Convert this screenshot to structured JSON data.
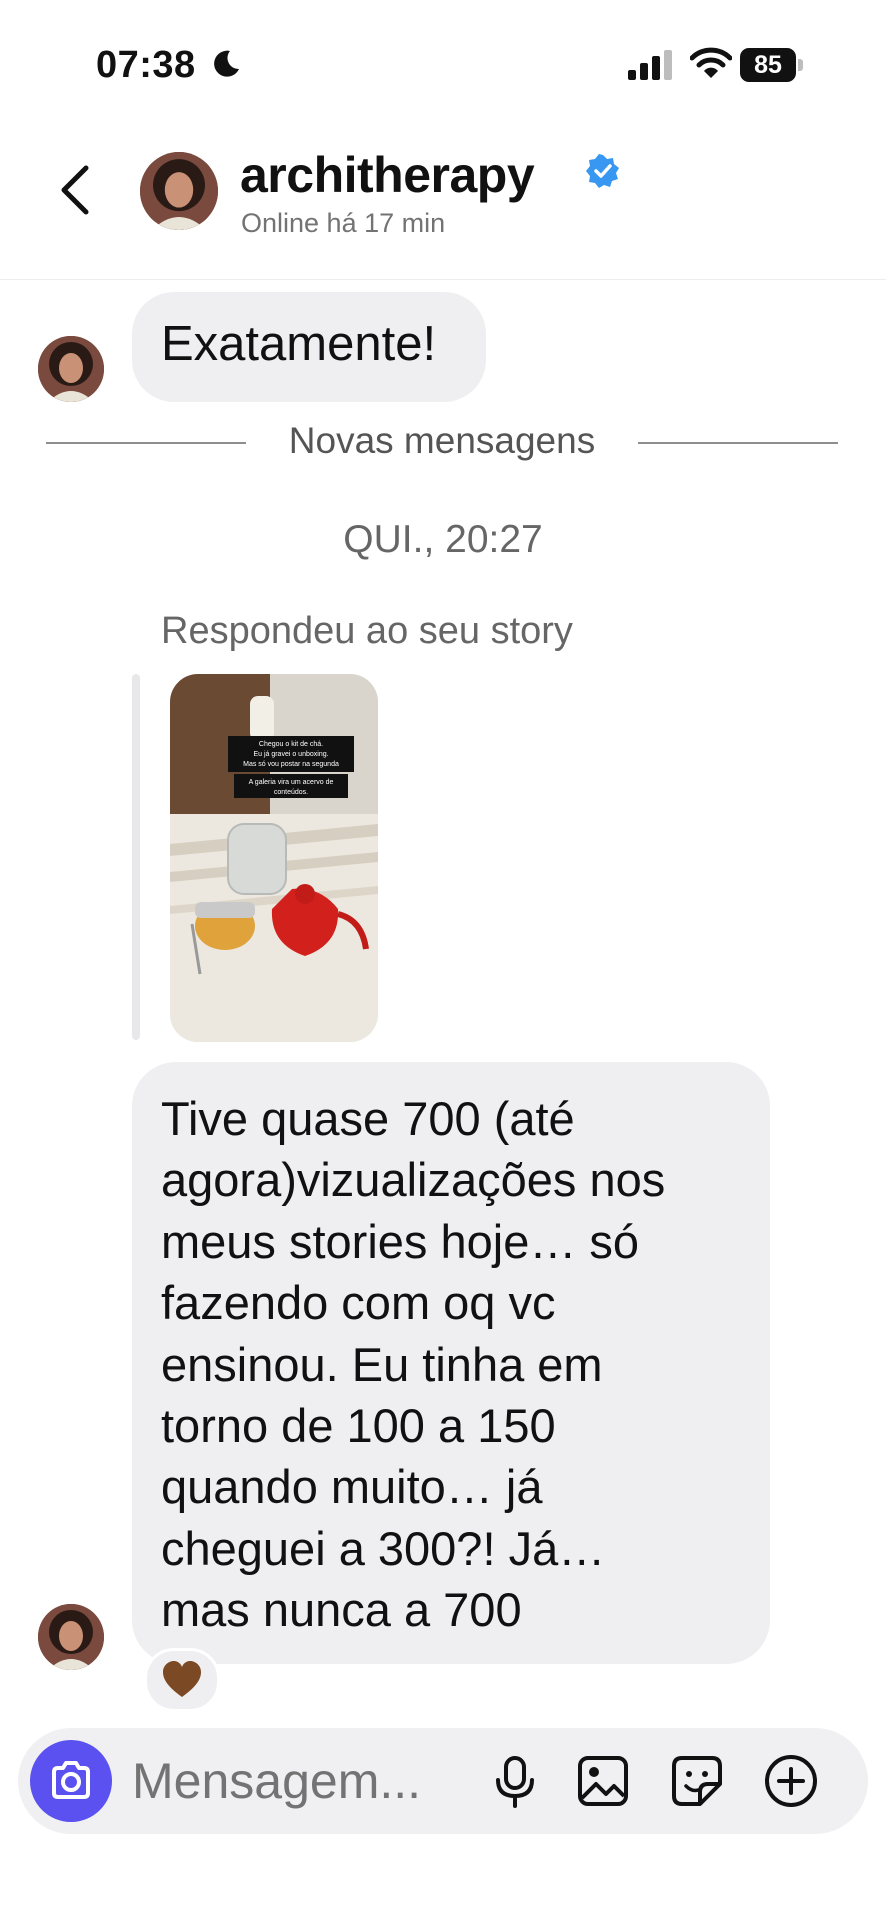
{
  "status_bar": {
    "time": "07:38",
    "battery": "85",
    "icons": [
      "moon-icon",
      "signal-icon",
      "wifi-icon",
      "battery-icon"
    ]
  },
  "header": {
    "username": "architherapy",
    "status": "Online há 17 min",
    "verified": true,
    "icons": [
      "back-chevron-icon",
      "verified-badge-icon"
    ]
  },
  "messages": {
    "first": "Exatamente!",
    "new_messages": "Novas mensagens",
    "date": "QUI., 20:27",
    "replied_label": "Respondeu ao seu story",
    "story_caption_1": "Chegou o kit de chá.\nEu já gravei o unboxing.\nMas só vou postar na segunda",
    "story_caption_2": "A galeria vira um acervo de\nconteúdos.",
    "main_text": "Tive quase 700 (até\nagora)vizualizações nos\nmeus stories hoje… só\nfazendo com oq vc\nensinou. Eu tinha em\ntorno de 100 a 150\nquando muito… já\ncheguei a 300?! Já…\nmas nunca a 700",
    "reaction": "🤎"
  },
  "composer": {
    "placeholder": "Mensagem...",
    "icons": [
      "camera-icon",
      "microphone-icon",
      "gallery-icon",
      "sticker-icon",
      "plus-circle-icon"
    ]
  },
  "colors": {
    "accent_blue": "#5b51f0",
    "verified_blue": "#3897f0",
    "bubble_gray": "#efeff1",
    "secondary_text": "#737373"
  }
}
